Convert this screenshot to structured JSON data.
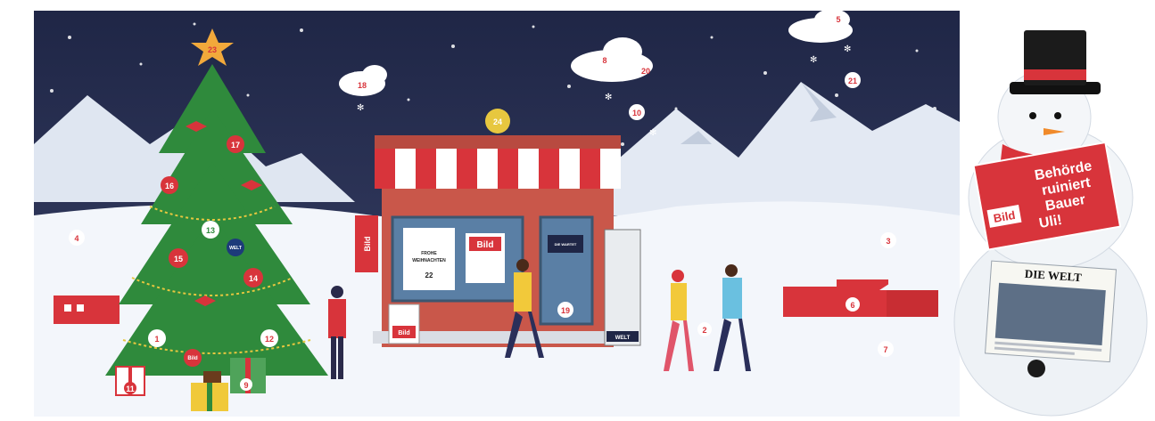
{
  "advent_calendar": {
    "door_numbers": [
      "1",
      "2",
      "3",
      "4",
      "5",
      "6",
      "7",
      "8",
      "9",
      "10",
      "11",
      "12",
      "13",
      "14",
      "15",
      "16",
      "17",
      "18",
      "19",
      "20",
      "21",
      "22",
      "23",
      "24"
    ],
    "colors": {
      "sky": "#2a3257",
      "tree_green": "#2f8a3c",
      "red": "#d8343b",
      "snow": "#f3f6fb",
      "star": "#f2a93b",
      "gold": "#e7c73f"
    }
  },
  "kiosk": {
    "bild_logo": "Bild",
    "welt_logo": "WELT",
    "window_sign": [
      "FROHE",
      "WEIHNACHTEN",
      "22"
    ],
    "window_paper_logo": "Bild",
    "door_sign": "DIE WARTET"
  },
  "snowman": {
    "bild_logo": "Bild",
    "bild_headline": [
      "Behörde",
      "ruiniert",
      "Bauer",
      "Uli!"
    ],
    "welt_logo": "DIE WELT"
  }
}
